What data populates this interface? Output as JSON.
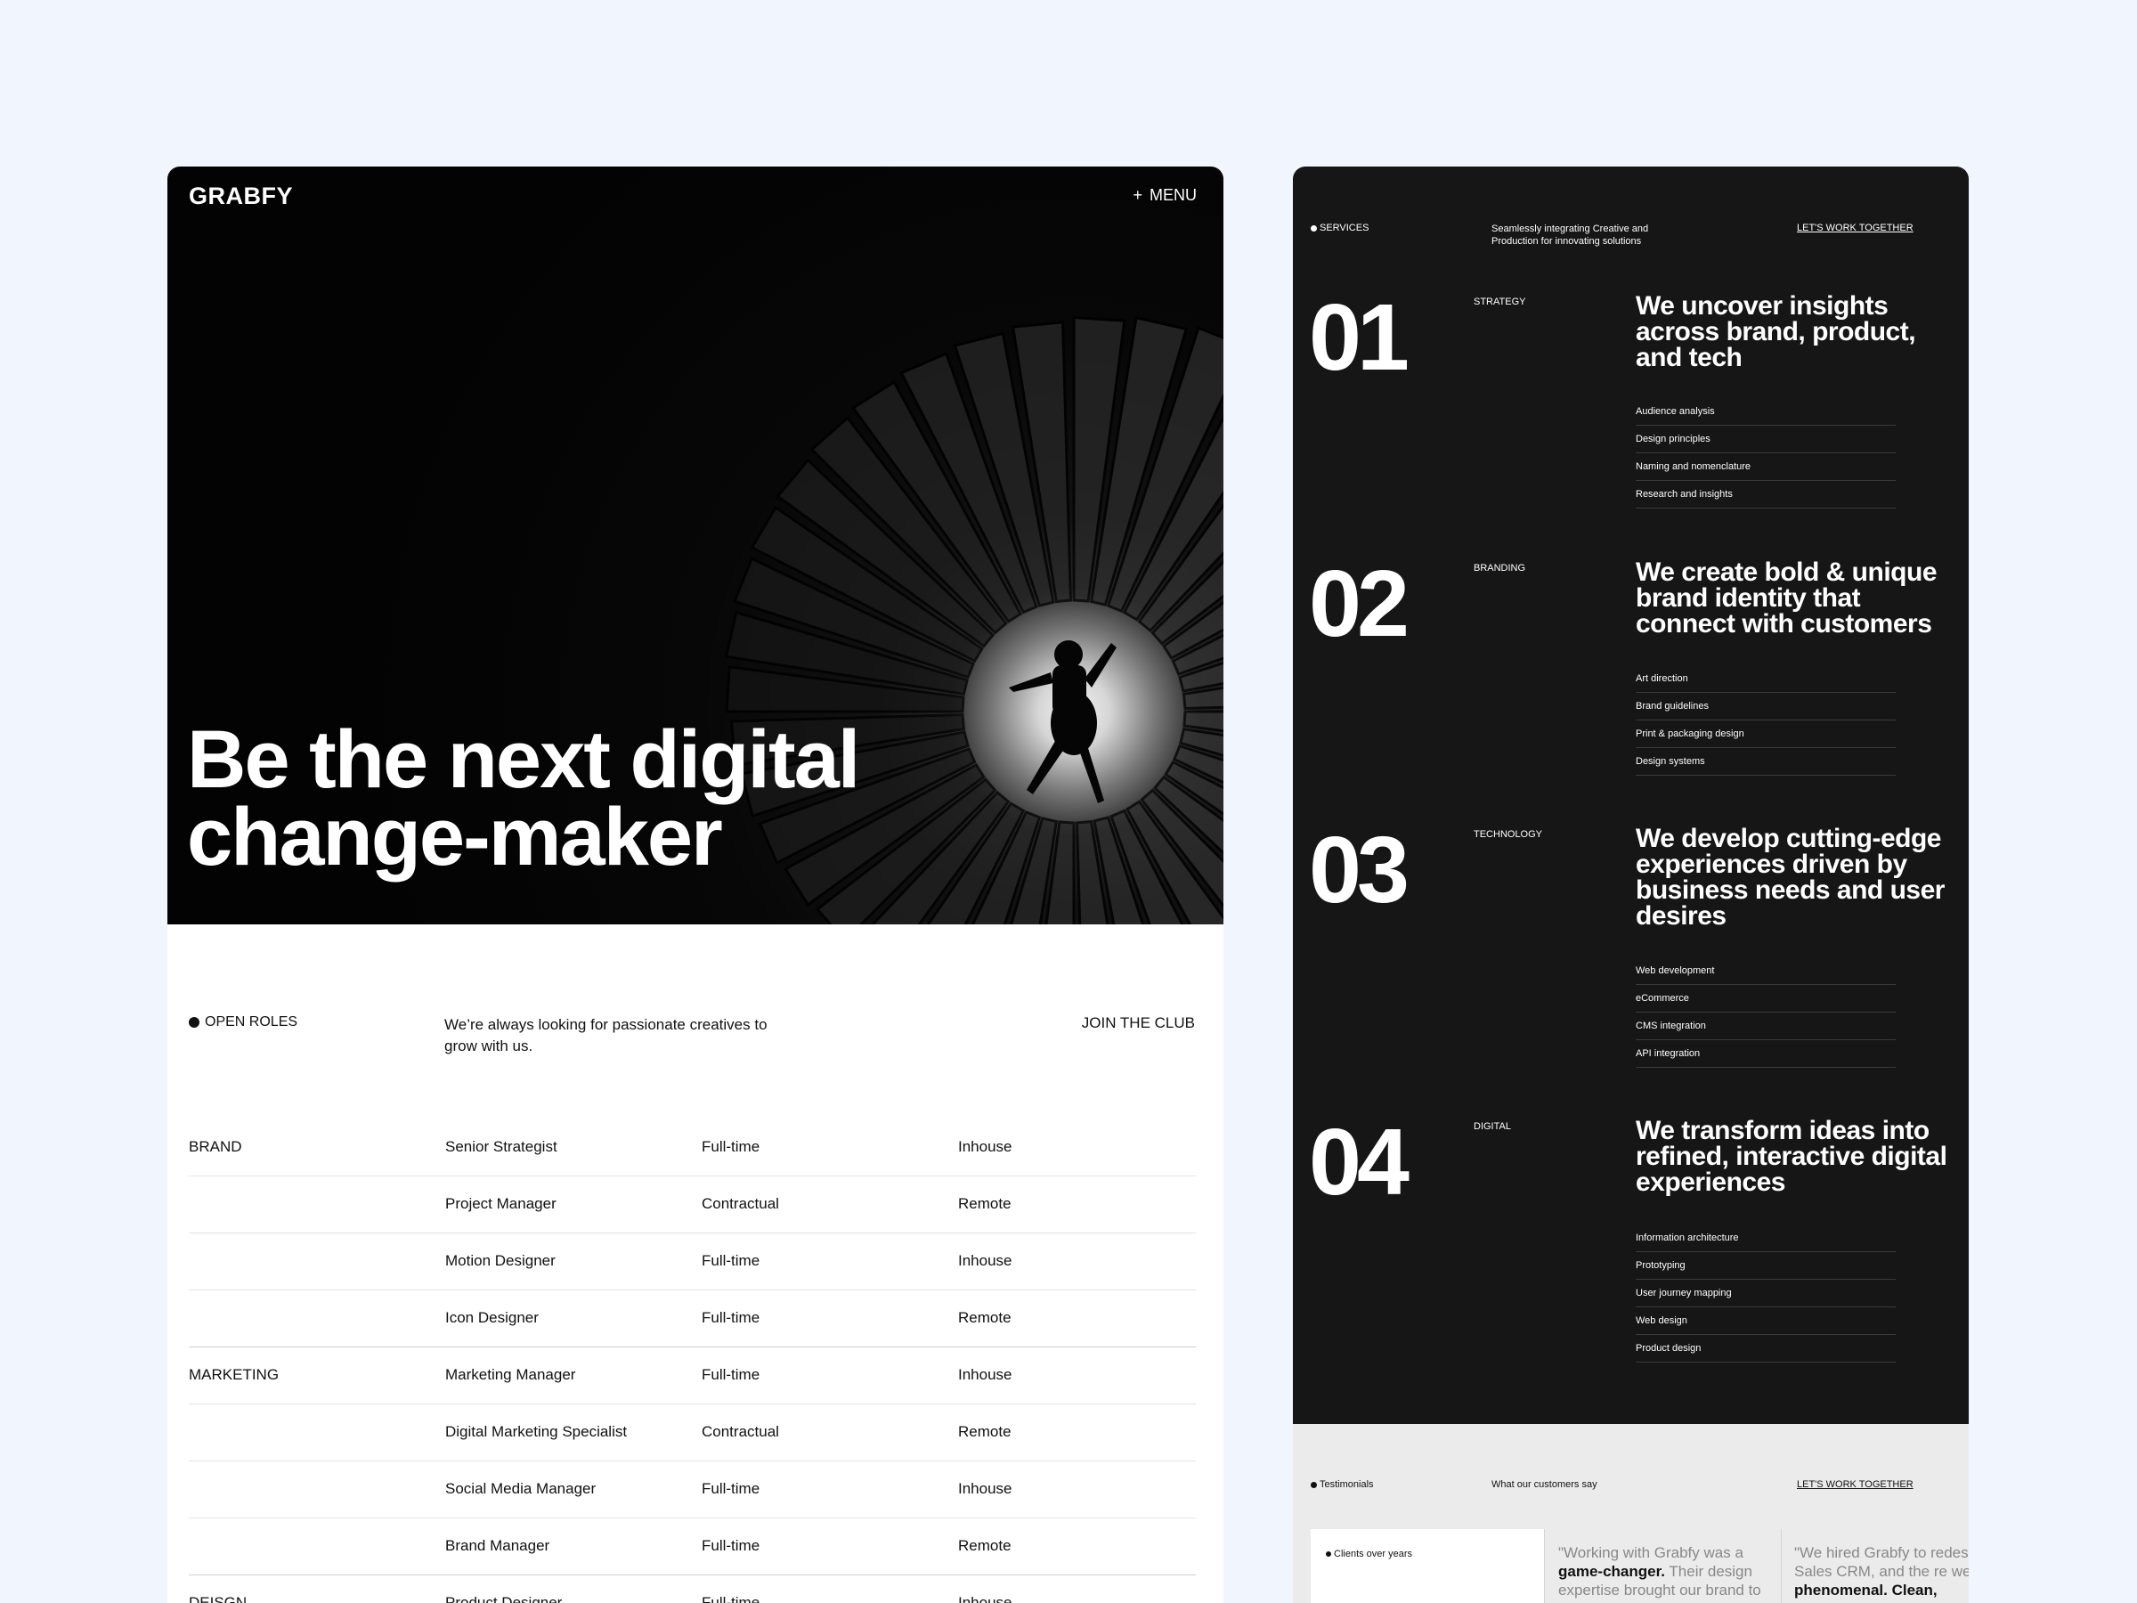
{
  "left": {
    "logo": "GRABFY",
    "menu_icon": "plus-icon",
    "menu_label": "MENU",
    "hero_title_line1": "Be the next digital",
    "hero_title_line2": "change-maker",
    "open_roles_label": "OPEN ROLES",
    "open_roles_desc": "We’re always looking for passionate creatives to grow with us.",
    "join_label": "JOIN THE CLUB",
    "roles": [
      {
        "dept": "BRAND",
        "title": "Senior Strategist",
        "type": "Full-time",
        "location": "Inhouse"
      },
      {
        "dept": "",
        "title": "Project Manager",
        "type": "Contractual",
        "location": "Remote"
      },
      {
        "dept": "",
        "title": "Motion Designer",
        "type": "Full-time",
        "location": "Inhouse"
      },
      {
        "dept": "",
        "title": "Icon Designer",
        "type": "Full-time",
        "location": "Remote"
      },
      {
        "dept": "MARKETING",
        "title": "Marketing Manager",
        "type": "Full-time",
        "location": "Inhouse"
      },
      {
        "dept": "",
        "title": "Digital Marketing Specialist",
        "type": "Contractual",
        "location": "Remote"
      },
      {
        "dept": "",
        "title": "Social Media Manager",
        "type": "Full-time",
        "location": "Inhouse"
      },
      {
        "dept": "",
        "title": "Brand Manager",
        "type": "Full-time",
        "location": "Remote"
      },
      {
        "dept": "DEISGN",
        "title": "Product Designer",
        "type": "Full-time",
        "location": "Inhouse"
      }
    ]
  },
  "right": {
    "services_label": "SERVICES",
    "services_desc": "Seamlessly integrating Creative and Production for innovating solutions",
    "work_link": "LET'S WORK TOGETHER",
    "services": [
      {
        "num": "01",
        "category": "STRATEGY",
        "title": "We uncover insights across brand, product, and tech",
        "items": [
          "Audience analysis",
          "Design principles",
          "Naming and nomenclature",
          "Research and insights"
        ]
      },
      {
        "num": "02",
        "category": "BRANDING",
        "title": "We create bold & unique brand identity that connect with customers",
        "items": [
          "Art direction",
          "Brand guidelines",
          "Print & packaging design",
          "Design systems"
        ]
      },
      {
        "num": "03",
        "category": "TECHNOLOGY",
        "title": "We develop cutting-edge experiences driven by business needs and user desires",
        "items": [
          "Web development",
          "eCommerce",
          "CMS integration",
          "API integration"
        ]
      },
      {
        "num": "04",
        "category": "DIGITAL",
        "title": "We transform ideas into refined, interactive digital experiences",
        "items": [
          "Information architecture",
          "Prototyping",
          "User journey mapping",
          "Web design",
          "Product design"
        ]
      }
    ],
    "testimonials": {
      "label": "Testimonials",
      "subtitle": "What our customers say",
      "link": "LET'S WORK TOGETHER",
      "clients_caption": "Clients over years",
      "quote1_a": "\"Working with Grabfy was a ",
      "quote1_b": "game-changer.",
      "quote1_c": " Their design expertise brought our brand to",
      "quote2_a": "\"We hired Grabfy to redes",
      "quote2_b": "our Sales CRM, and the re were ",
      "quote2_c": "phenomenal. Clean,"
    }
  }
}
